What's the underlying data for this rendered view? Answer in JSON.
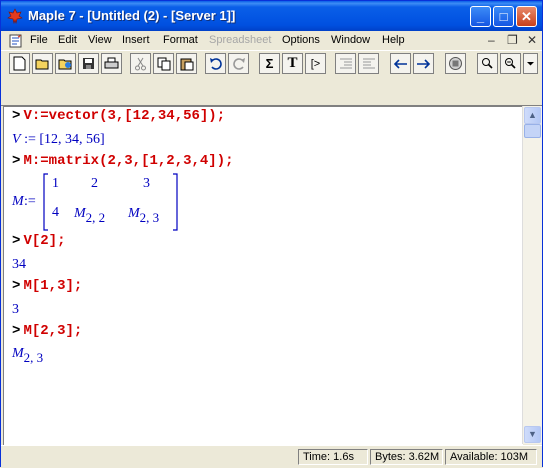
{
  "window": {
    "title": "Maple 7  - [Untitled (2) - [Server 1]]",
    "controls": {
      "minimize": "_",
      "maximize": "□",
      "close": "✕"
    }
  },
  "menu": {
    "items": [
      {
        "label": "File",
        "enabled": true
      },
      {
        "label": "Edit",
        "enabled": true
      },
      {
        "label": "View",
        "enabled": true
      },
      {
        "label": "Insert",
        "enabled": true
      },
      {
        "label": "Format",
        "enabled": true
      },
      {
        "label": "Spreadsheet",
        "enabled": false
      },
      {
        "label": "Options",
        "enabled": true
      },
      {
        "label": "Window",
        "enabled": true
      },
      {
        "label": "Help",
        "enabled": true
      }
    ],
    "mdi_controls": {
      "minimize": "–",
      "restore": "❐",
      "close": "✕"
    }
  },
  "toolbar": {
    "buttons": [
      {
        "name": "new-icon"
      },
      {
        "name": "open-icon"
      },
      {
        "name": "open-url-icon"
      },
      {
        "name": "save-icon"
      },
      {
        "name": "print-icon"
      },
      {
        "name": "cut-icon"
      },
      {
        "name": "copy-icon"
      },
      {
        "name": "paste-icon"
      },
      {
        "name": "undo-icon"
      },
      {
        "name": "redo-icon"
      },
      {
        "name": "sigma-icon",
        "glyph": "Σ"
      },
      {
        "name": "text-icon",
        "glyph": "T"
      },
      {
        "name": "prompt-icon",
        "glyph": "[>"
      },
      {
        "name": "indent-icon"
      },
      {
        "name": "outdent-icon"
      },
      {
        "name": "back-icon"
      },
      {
        "name": "forward-icon"
      },
      {
        "name": "stop-icon"
      },
      {
        "name": "zoom-in-icon"
      },
      {
        "name": "zoom-out-icon"
      }
    ]
  },
  "worksheet": {
    "prompt": ">",
    "lines": [
      {
        "type": "input",
        "text": "V:=vector(3,[12,34,56]);"
      },
      {
        "type": "output",
        "lhs": "V",
        "assign": " := ",
        "rhs": "[12, 34, 56]"
      },
      {
        "type": "input",
        "text": "M:=matrix(2,3,[1,2,3,4]);"
      },
      {
        "type": "matrix",
        "lhs": "M",
        "assign": ":=",
        "row1": [
          "1",
          "2",
          "3"
        ],
        "row2": [
          "4",
          "M",
          "2, 2",
          "M",
          "2, 3"
        ]
      },
      {
        "type": "input",
        "text": "V[2];"
      },
      {
        "type": "output",
        "rhs": "34"
      },
      {
        "type": "input",
        "text": "M[1,3];"
      },
      {
        "type": "output",
        "rhs": "3"
      },
      {
        "type": "input",
        "text": "M[2,3];"
      },
      {
        "type": "output-sub",
        "base": "M",
        "sub": "2, 3"
      }
    ]
  },
  "status": {
    "time": "Time:   1.6s",
    "bytes": "Bytes: 3.62M",
    "available": "Available: 103M"
  }
}
